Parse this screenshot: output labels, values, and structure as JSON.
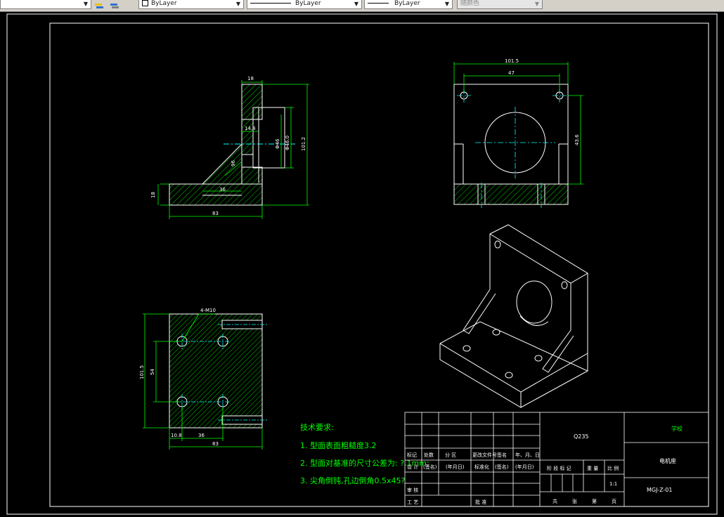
{
  "toolbar": {
    "color_value": "ByLayer",
    "linetype_value": "ByLayer",
    "lineweight_value": "ByLayer",
    "plotstyle_value": "随颜色",
    "icons": [
      "layer-states-icon",
      "layer-previous-icon"
    ]
  },
  "views": {
    "side": {
      "dim_top": "18",
      "dim_hole_depth": "14.4",
      "dim_hole_dia": "Φ46",
      "dim_hole_dia2": "Φ46.0",
      "dim_total_height": "101.2",
      "dim_rib_height": "96",
      "dim_rib_width": "36",
      "dim_base_thick": "18",
      "dim_length": "83"
    },
    "front": {
      "dim_total_width": "101.5",
      "dim_hole_spacing": "47",
      "dim_height": "43.6"
    },
    "top": {
      "hole_note": "4-M10",
      "dim_width": "101.5",
      "dim_hole_spacing": "54",
      "dim_left": "10.8",
      "dim_hole_pitch": "36",
      "dim_length": "83"
    }
  },
  "tech": {
    "title": "技术要求:",
    "lines": [
      "1. 型面表面粗糙度3.2",
      "2. 型面对基准的尺寸公差为: ?.1mm;",
      "3. 尖角倒钝,孔边倒角0.5x45?"
    ]
  },
  "title_block": {
    "material": "Q235",
    "school": "学校",
    "part_name": "电机座",
    "drawing_no": "MGJ-Z-01",
    "scale": "1:1",
    "rev_headers": [
      "标记",
      "处数",
      "分 区",
      "更改文件号",
      "签名",
      "年、月、日"
    ],
    "design_row": [
      "设 计",
      "(签名)",
      "(年月日)",
      "标准化",
      "(签名)",
      "(年月日)"
    ],
    "stage_headers": [
      "阶 段 标 记",
      "重 量",
      "比 例"
    ],
    "review": "审 核",
    "process": "工 艺",
    "approve": "批 准",
    "sheets": [
      "共",
      "张",
      "第",
      "页"
    ]
  }
}
